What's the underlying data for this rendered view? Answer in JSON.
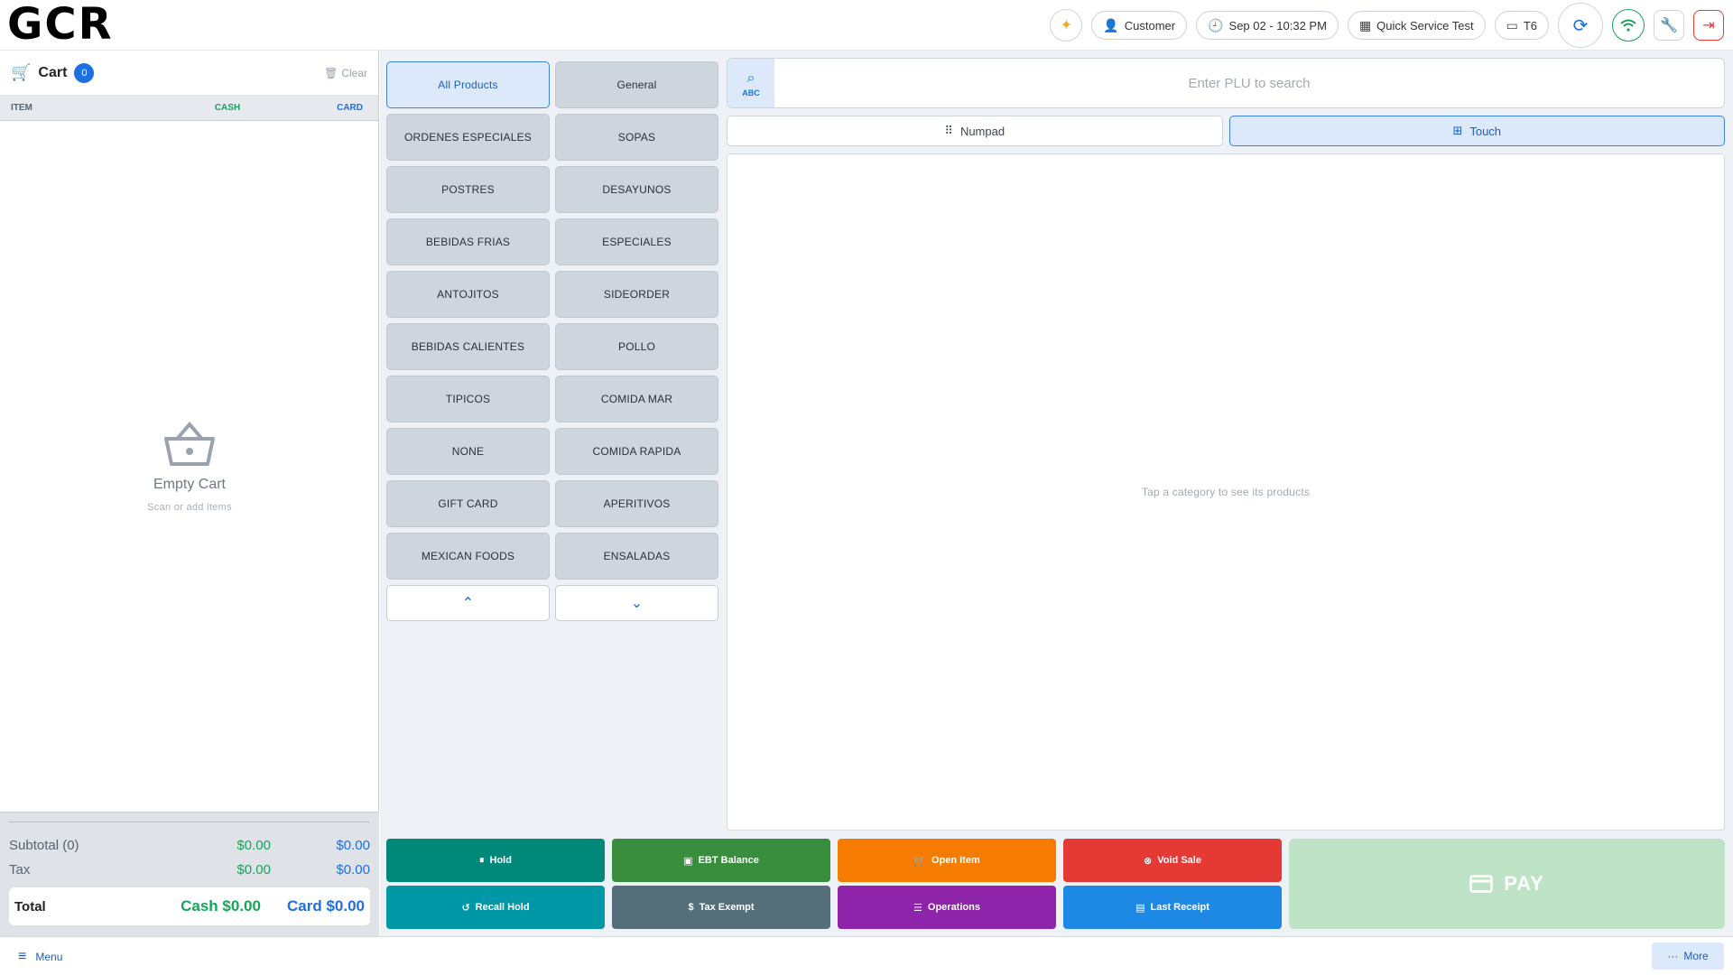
{
  "header": {
    "logo_text": "GCR",
    "customer_label": "Customer",
    "datetime": "Sep 02 - 10:32 PM",
    "store_label": "Quick Service Test",
    "terminal_label": "T6"
  },
  "cart": {
    "title": "Cart",
    "count": "0",
    "clear_label": "Clear",
    "columns": {
      "item": "ITEM",
      "cash": "CASH",
      "card": "CARD"
    },
    "empty_title": "Empty Cart",
    "empty_subtitle": "Scan or add items",
    "subtotal_label": "Subtotal (0)",
    "subtotal_cash": "$0.00",
    "subtotal_card": "$0.00",
    "tax_label": "Tax",
    "tax_cash": "$0.00",
    "tax_card": "$0.00",
    "total_label": "Total",
    "total_cash": "Cash $0.00",
    "total_card": "Card $0.00"
  },
  "categories": [
    "All Products",
    "General",
    "ORDENES ESPECIALES",
    "SOPAS",
    "POSTRES",
    "DESAYUNOS",
    "BEBIDAS FRIAS",
    "ESPECIALES",
    "ANTOJITOS",
    "SIDEORDER",
    "BEBIDAS CALIENTES",
    "POLLO",
    "TIPICOS",
    "COMIDA MAR",
    "NONE",
    "COMIDA RAPIDA",
    "GIFT CARD",
    "APERITIVOS",
    "MEXICAN FOODS",
    "ENSALADAS"
  ],
  "search": {
    "placeholder": "Enter PLU to search",
    "mode_label": "ABC"
  },
  "modes": {
    "numpad": "Numpad",
    "touch": "Touch"
  },
  "products_hint": "Tap a category to see its products",
  "actions": {
    "hold": "Hold",
    "ebt_balance": "EBT Balance",
    "open_item": "Open Item",
    "void_sale": "Void Sale",
    "recall_hold": "Recall Hold",
    "tax_exempt": "Tax Exempt",
    "operations": "Operations",
    "last_receipt": "Last Receipt",
    "pay": "PAY"
  },
  "colors": {
    "accent": "#1e6fe0",
    "cash_green": "#19a35a",
    "hold": "#00897b",
    "ebt": "#388e3c",
    "open_item": "#f57c00",
    "void": "#e53935",
    "recall": "#0097a7",
    "tax_exempt": "#546e7a",
    "operations": "#8e24aa",
    "last_receipt": "#1e88e5",
    "pay": "#bfe3c7"
  },
  "footer": {
    "menu_label": "Menu",
    "more_label": "More"
  }
}
